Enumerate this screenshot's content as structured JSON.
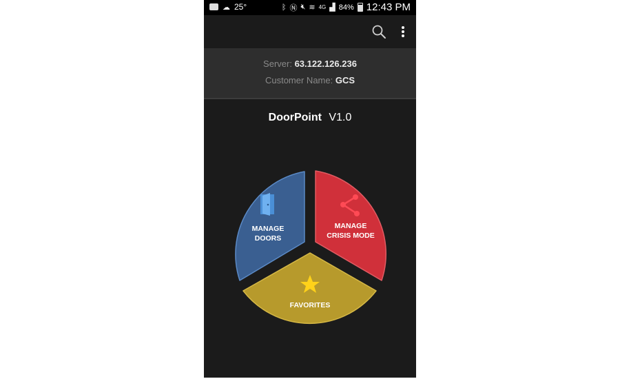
{
  "status_bar": {
    "temperature": "25°",
    "network": "4G",
    "battery": "84%",
    "time": "12:43 PM",
    "icons": [
      "message-icon",
      "weather-icon",
      "bluetooth-icon",
      "nfc-icon",
      "mute-icon",
      "wifi-icon",
      "signal-icon",
      "battery-icon"
    ]
  },
  "app_bar": {
    "icons": [
      "search-icon",
      "overflow-menu-icon"
    ]
  },
  "server_info": {
    "server_label": "Server:",
    "server_value": "63.122.126.236",
    "customer_label": "Customer Name:",
    "customer_value": "GCS"
  },
  "app": {
    "name": "DoorPoint",
    "version": "V1.0"
  },
  "menu": {
    "manage_doors": {
      "line1": "MANAGE",
      "line2": "DOORS",
      "color": "#3a5f91",
      "icon": "door-icon"
    },
    "crisis_mode": {
      "line1": "MANAGE",
      "line2": "CRISIS MODE",
      "color": "#d0303a",
      "icon": "share-network-icon"
    },
    "favorites": {
      "label": "FAVORITES",
      "color": "#b79a2c",
      "icon": "star-icon"
    }
  },
  "colors": {
    "background": "#1b1b1b",
    "panel": "#2e2e2e",
    "status_bar": "#000000"
  }
}
